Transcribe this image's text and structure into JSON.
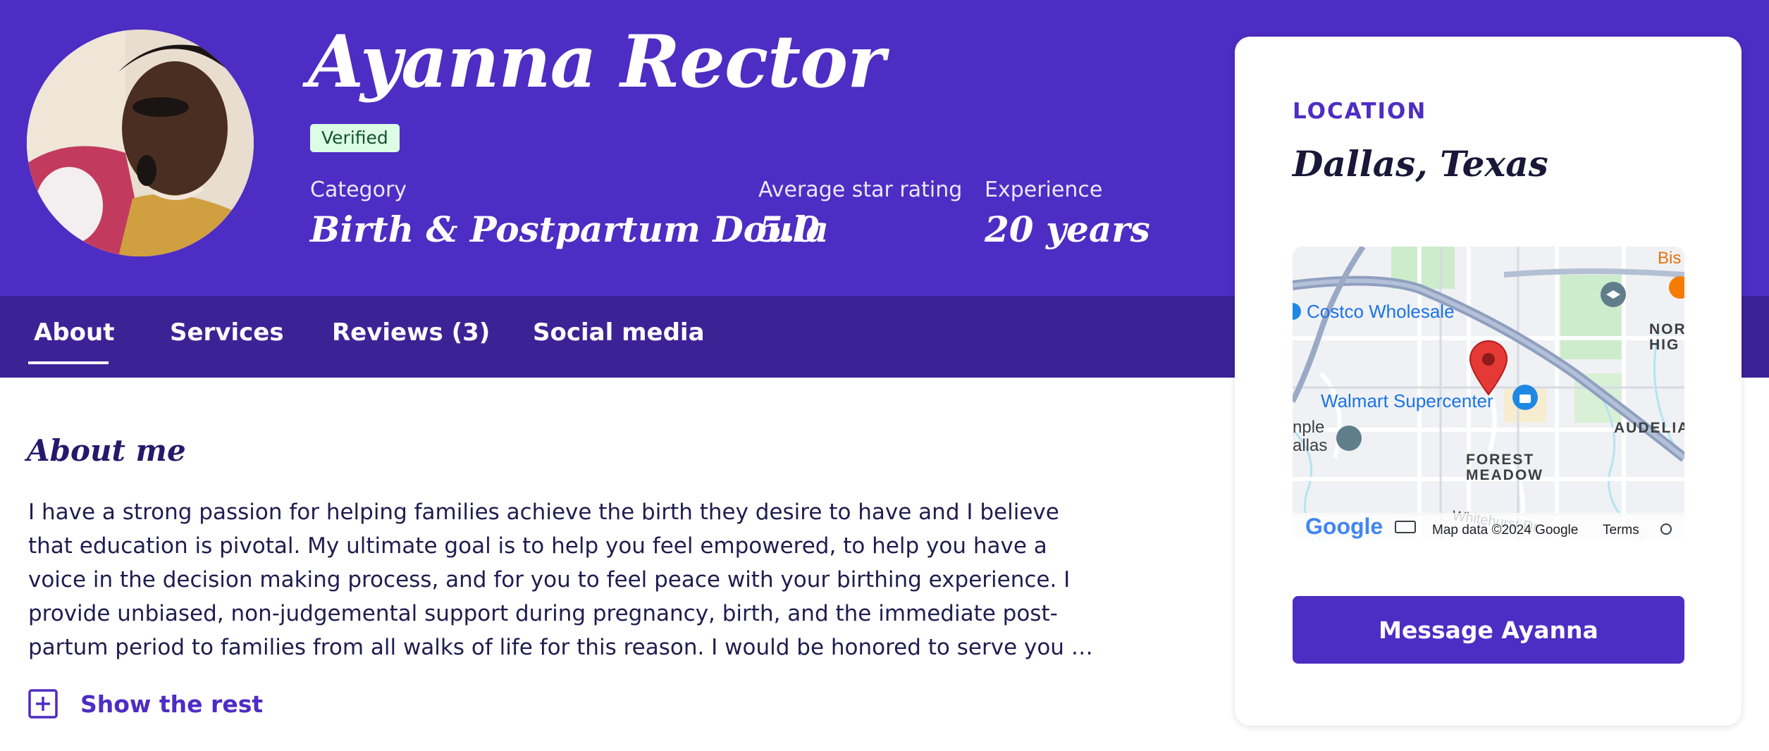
{
  "profile": {
    "name": "Ayanna Rector",
    "badge": "Verified"
  },
  "stats": [
    {
      "label": "Category",
      "value": "Birth & Postpartum Doula"
    },
    {
      "label": "Average star rating",
      "value": "5.0"
    },
    {
      "label": "Experience",
      "value": "20 years"
    }
  ],
  "tabs": [
    {
      "label": "About",
      "active": true
    },
    {
      "label": "Services"
    },
    {
      "label": "Reviews (3)"
    },
    {
      "label": "Social media"
    }
  ],
  "about": {
    "heading": "About me",
    "lines": [
      "I have a strong passion for helping families achieve the birth they desire to have and I believe",
      "that education is pivotal. My ultimate goal is to help you feel empowered, to help you have a",
      "voice in the decision making process, and for you to feel peace with your birthing experience. I",
      "provide unbiased, non-judgemental support during pregnancy, birth, and the immediate post-",
      "partum period to families from all walks of life for this reason. I would be honored to serve you …"
    ],
    "show_rest_label": "Show the rest",
    "show_rest_icon": "plus-square-icon"
  },
  "location": {
    "label": "LOCATION",
    "value": "Dallas, Texas"
  },
  "map": {
    "labels": {
      "costco": "Costco Wholesale",
      "walmart": "Walmart Supercenter",
      "forest": "FOREST",
      "meadow": "MEADOW",
      "audelia": "AUDELIA",
      "nor": "NOR",
      "hig": "HIG",
      "temple": "nple",
      "dallas": "allas",
      "bis": "Bis",
      "whitehurst": "Whitehurst Dr"
    },
    "logo": "Google",
    "attribution": "Map data ©2024 Google",
    "terms": "Terms",
    "colors": {
      "pin": "#e53935",
      "water": "#b4e4f2",
      "park": "#cdeccb",
      "highway": "#9aa9c4",
      "poi_blue": "#1e88e5"
    }
  },
  "actions": {
    "message_label": "Message Ayanna"
  },
  "colors": {
    "primary": "#4d2dc3",
    "tabbar": "#3d2296",
    "badge_bg": "#dcfce4",
    "badge_text": "#14532d"
  }
}
